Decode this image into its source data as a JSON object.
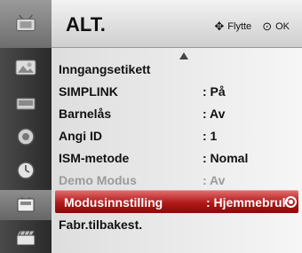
{
  "header": {
    "title": "ALT.",
    "move_hint": "Flytte",
    "ok_hint": "OK"
  },
  "rail": {
    "icons": [
      "antenna-setup-icon",
      "picture-icon",
      "audio-icon",
      "time-icon",
      "options-icon",
      "input-icon"
    ]
  },
  "menu": {
    "items": [
      {
        "label": "Inngangsetikett",
        "value": ""
      },
      {
        "label": "SIMPLINK",
        "value": ": På"
      },
      {
        "label": "Barnelås",
        "value": ": Av"
      },
      {
        "label": "Angi ID",
        "value": ": 1"
      },
      {
        "label": "ISM-metode",
        "value": ": Nomal"
      },
      {
        "label": "Demo Modus",
        "value": ": Av"
      },
      {
        "label": "Modusinnstilling",
        "value": ": Hjemmebruk"
      },
      {
        "label": "Fabr.tilbakest.",
        "value": ""
      }
    ]
  },
  "colors": {
    "selection": "#b01818",
    "disabled_text": "#9b9b9b"
  }
}
